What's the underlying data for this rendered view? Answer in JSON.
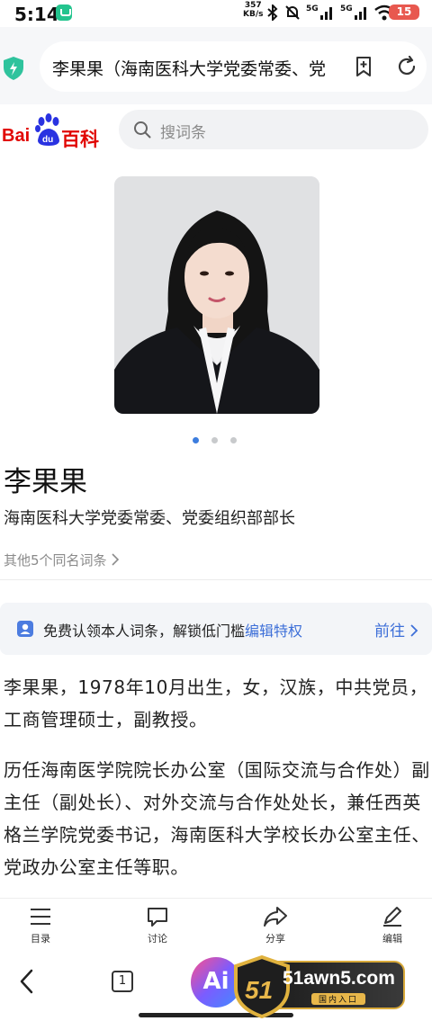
{
  "status_bar": {
    "time": "5:14",
    "speed_value": "357",
    "speed_unit": "KB/s",
    "network_1": "5G",
    "network_2": "5G",
    "battery": "15"
  },
  "browser": {
    "url_text": "李果果（海南医科大学党委常委、党"
  },
  "baike": {
    "logo_bai": "Bai",
    "logo_du": "du",
    "logo_baike": "百科",
    "search_placeholder": "搜词条"
  },
  "entry": {
    "title": "李果果",
    "subtitle": "海南医科大学党委常委、党委组织部部长",
    "same_name_link": "其他5个同名词条",
    "claim_text": "免费认领本人词条，解锁低门槛",
    "claim_link": "编辑特权",
    "claim_go": "前往",
    "paragraph_1": "李果果，1978年10月出生，女，汉族，中共党员，工商管理硕士，副教授。",
    "paragraph_2": "历任海南医学院院长办公室（国际交流与合作处）副主任（副处长）、对外交流与合作处处长，兼任西英格兰学院党委书记，海南医科大学校长办公室主任、党政办公室主任等职。"
  },
  "carousel": {
    "count": 3,
    "active_index": 0
  },
  "toolbar": {
    "items": [
      {
        "label": "目录",
        "icon": "menu-list-icon"
      },
      {
        "label": "讨论",
        "icon": "chat-bubble-icon"
      },
      {
        "label": "分享",
        "icon": "share-arrow-icon"
      },
      {
        "label": "编辑",
        "icon": "pencil-icon"
      }
    ]
  },
  "nav": {
    "tab_count": "1",
    "ai_label": "Ai"
  },
  "watermark": {
    "badge": "51",
    "domain": "51awn5.com",
    "subtitle": "国内入口"
  },
  "colors": {
    "baidu_red": "#e10602",
    "link_blue": "#3d6fd8",
    "carousel_active": "#3c7dde"
  }
}
